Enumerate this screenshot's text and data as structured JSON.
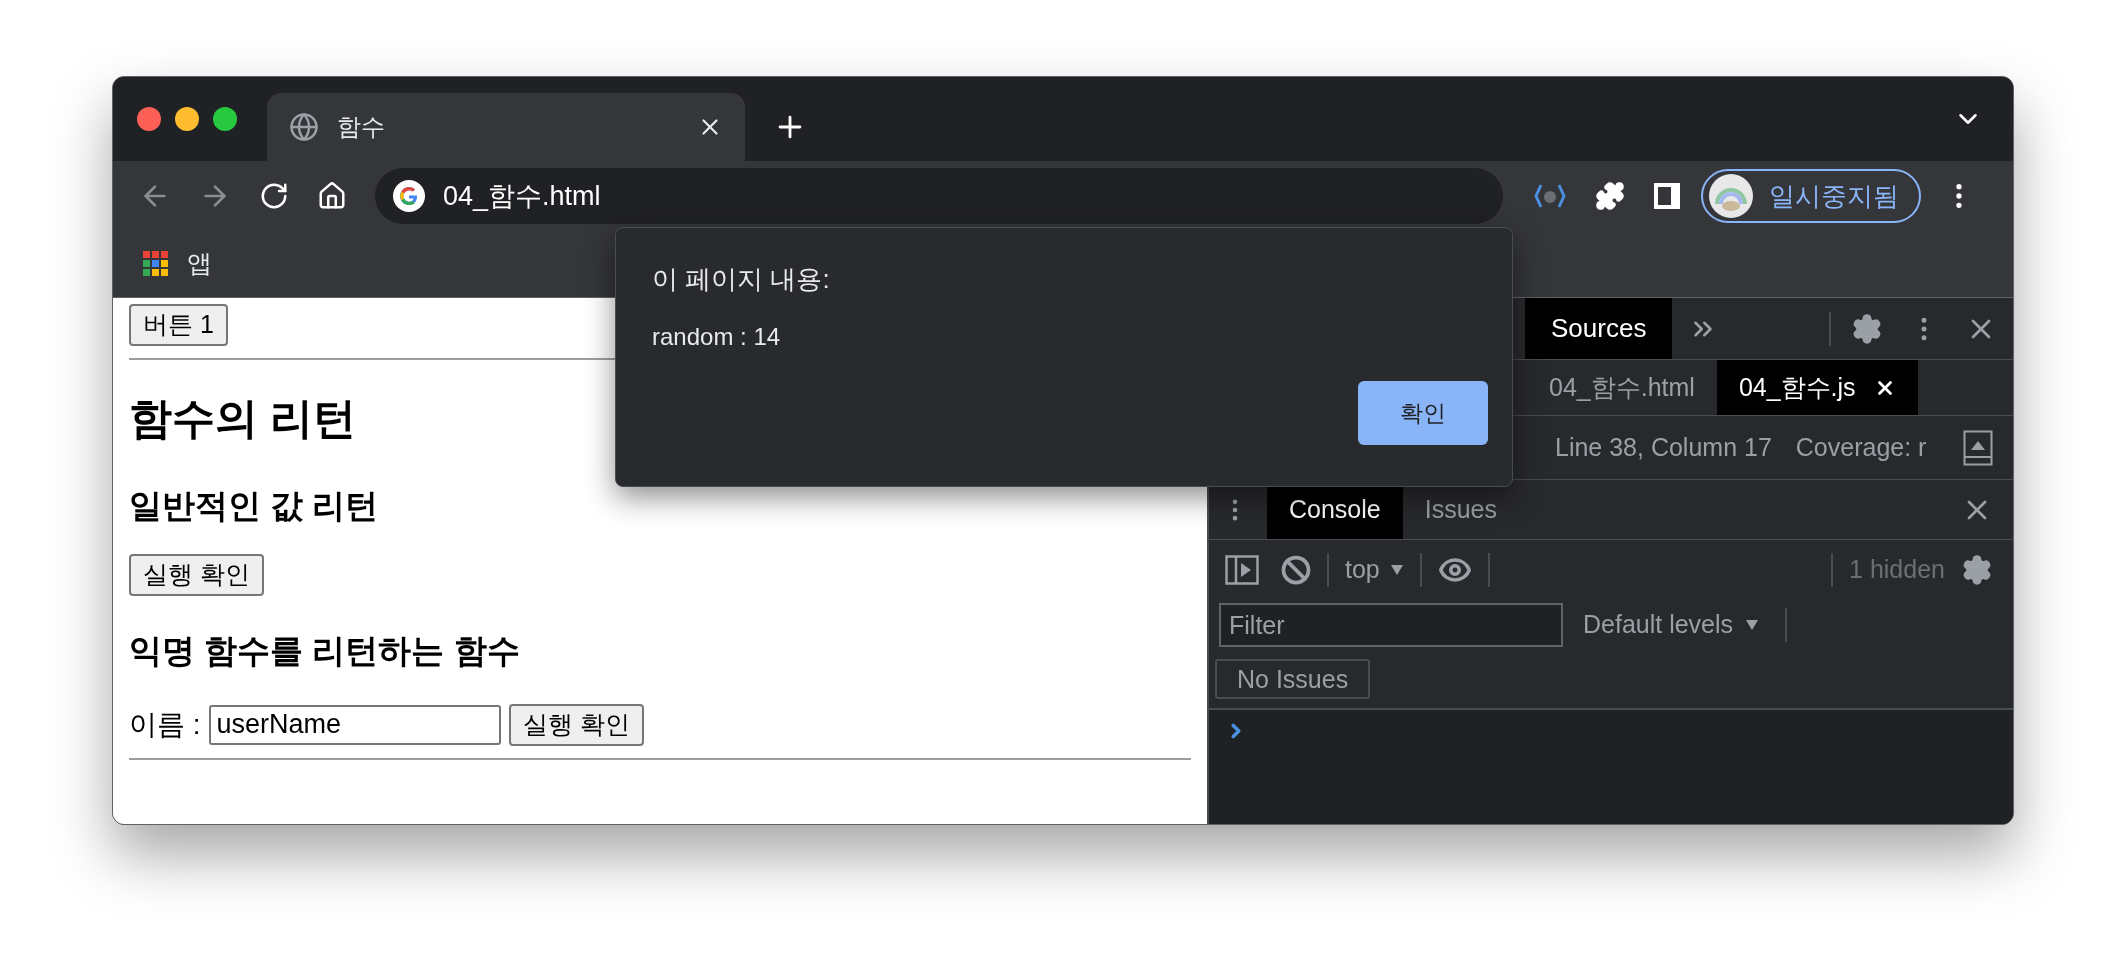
{
  "browser": {
    "tabs": [
      {
        "title": "함수",
        "selected": true
      }
    ],
    "address": "04_함수.html",
    "bookmarks": [
      {
        "label": "앱"
      }
    ],
    "profile": {
      "label": "일시중지됨"
    }
  },
  "page": {
    "blocks": [
      {
        "kind": "button",
        "label": "버튼 1"
      },
      {
        "kind": "rule"
      },
      {
        "kind": "h1",
        "text": "함수의 리턴"
      },
      {
        "kind": "h2",
        "text": "일반적인 값 리턴"
      },
      {
        "kind": "button",
        "label": "실행 확인"
      },
      {
        "kind": "h2",
        "text": "익명 함수를 리턴하는 함수"
      },
      {
        "kind": "form",
        "label": "이름 :",
        "value": "userName",
        "button": "실행 확인"
      },
      {
        "kind": "rule"
      }
    ]
  },
  "dialog": {
    "title": "이 페이지 내용:",
    "message": "random : 14",
    "ok_button": "확인"
  },
  "devtools": {
    "panel_tabs": [
      {
        "label": "Sources",
        "selected": true
      }
    ],
    "file_tabs": [
      {
        "label": "04_함수.html",
        "selected": false
      },
      {
        "label": "04_함수.js",
        "selected": true
      }
    ],
    "status": {
      "position": "Line 38, Column 17",
      "coverage": "Coverage: r"
    },
    "drawer_tabs": [
      {
        "label": "Console",
        "selected": true
      },
      {
        "label": "Issues",
        "selected": false
      }
    ],
    "context": "top",
    "hidden_count": "1 hidden",
    "filter": {
      "placeholder": "Filter"
    },
    "levels": "Default levels",
    "issues_button": "No Issues"
  }
}
